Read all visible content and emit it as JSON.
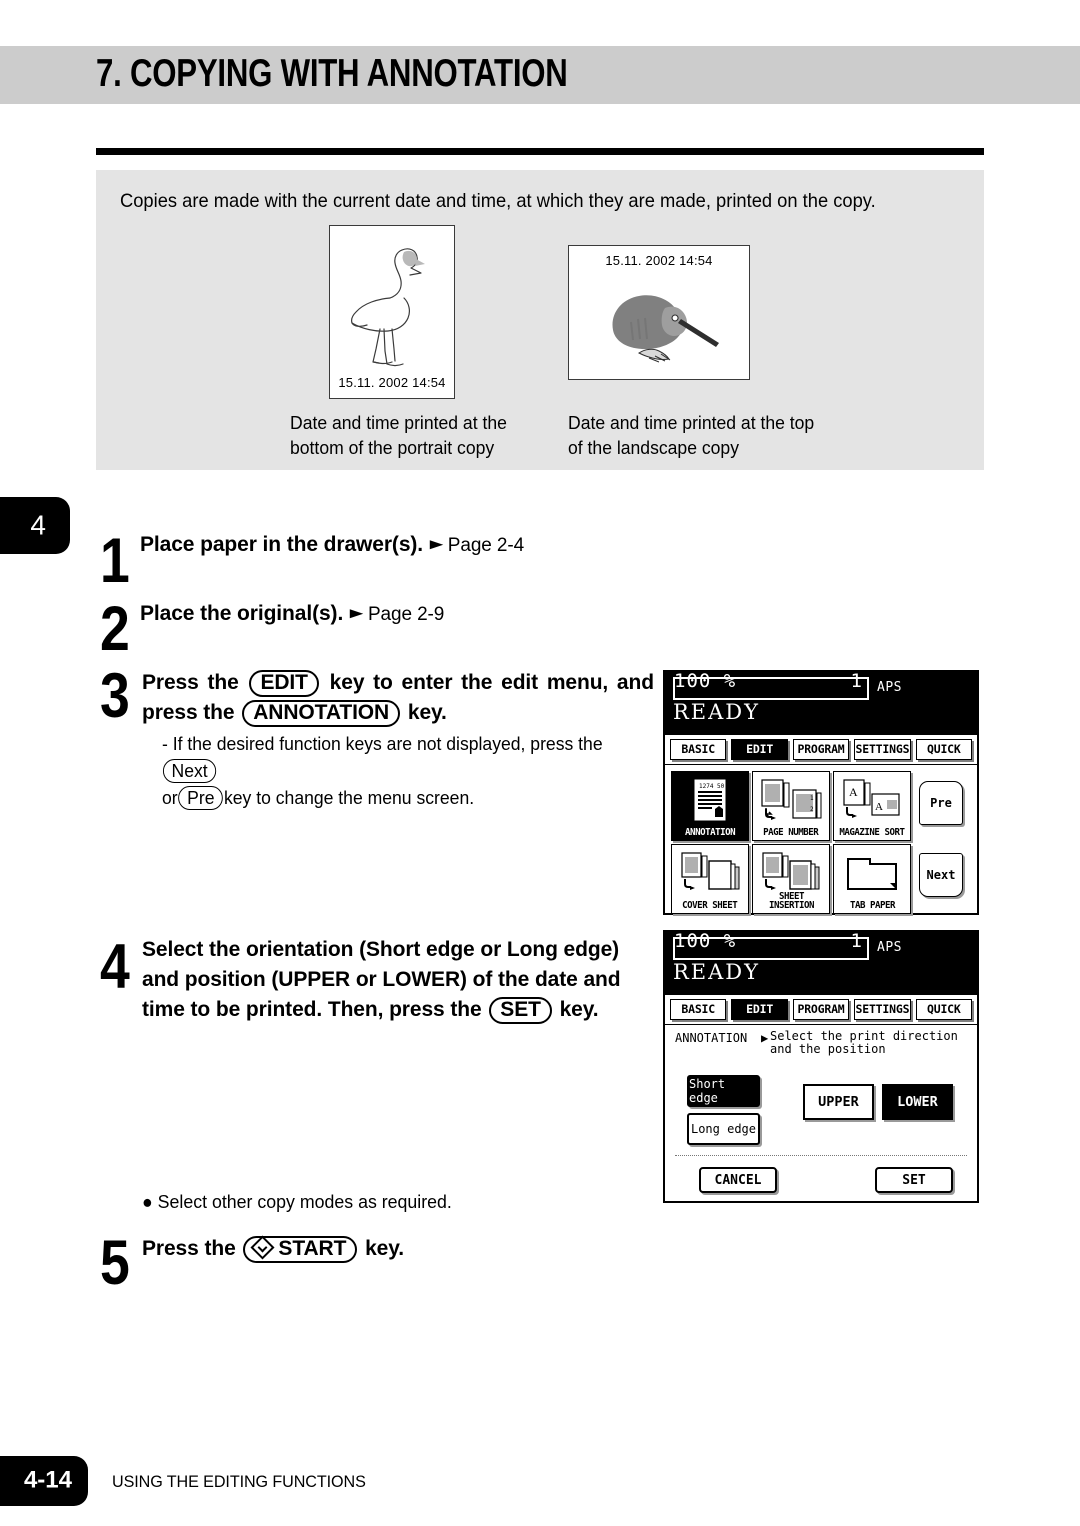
{
  "header": {
    "chapter_title": "7. COPYING WITH ANNOTATION",
    "chapter_tab_number": "4"
  },
  "intro": {
    "description": "Copies are made with the current date and time, at which they are made, printed on the copy.",
    "portrait_sample": {
      "icon": "flamingo-illustration",
      "stamp": "15.11. 2002  14:54",
      "caption": "Date and time printed at the\nbottom of the portrait copy"
    },
    "landscape_sample": {
      "icon": "kiwi-bird-illustration",
      "stamp": "15.11. 2002  14:54",
      "caption": "Date and time printed at the top\nof the landscape copy"
    }
  },
  "steps": [
    {
      "number": "1",
      "text": "Place paper in the drawer(s).",
      "page_ref": "Page 2-4"
    },
    {
      "number": "2",
      "text": "Place the original(s).",
      "page_ref": "Page 2-9"
    },
    {
      "number": "3",
      "text_part1": "Press the",
      "key1": "EDIT",
      "text_part2": "key to enter the edit menu, and",
      "text_part3": "press the",
      "key2": "ANNOTATION",
      "text_part4": "key.",
      "note_part1": "-  If the desired function keys are not displayed, press the",
      "note_key1": "Next",
      "note_part2": "or",
      "note_key2": "Pre",
      "note_part3": "key to change the menu screen."
    },
    {
      "number": "4",
      "line1": "Select the orientation (Short edge or Long edge)",
      "line2": "and position (UPPER or LOWER) of the date and",
      "line3_part1": "time to be printed. Then, press the",
      "key": "SET",
      "line3_part2": "key."
    },
    {
      "number": "5",
      "bullet": "Select other copy modes as required.",
      "text_part1": "Press the",
      "key": "START",
      "text_part2": "key."
    }
  ],
  "lcd_edit_menu": {
    "ratio": "100 %",
    "copies": "1",
    "paper_mode": "APS",
    "status": "READY",
    "tabs": [
      {
        "label": "BASIC",
        "active": false
      },
      {
        "label": "EDIT",
        "active": true
      },
      {
        "label": "PROGRAM",
        "active": false
      },
      {
        "label": "SETTINGS",
        "active": false
      },
      {
        "label": "QUICK",
        "active": false
      }
    ],
    "function_keys": [
      {
        "label": "ANNOTATION",
        "icon": "annotation-page-icon",
        "active": true
      },
      {
        "label": "PAGE NUMBER",
        "icon": "page-number-icon",
        "active": false
      },
      {
        "label": "MAGAZINE SORT",
        "icon": "magazine-sort-icon",
        "active": false
      },
      {
        "label": "COVER SHEET",
        "icon": "cover-sheet-icon",
        "active": false
      },
      {
        "label": "SHEET\nINSERTION",
        "icon": "sheet-insertion-icon",
        "active": false
      },
      {
        "label": "TAB PAPER",
        "icon": "tab-paper-icon",
        "active": false
      }
    ],
    "pager": {
      "previous_label": "Pre",
      "next_label": "Next"
    }
  },
  "lcd_annotation_setup": {
    "ratio": "100 %",
    "copies": "1",
    "paper_mode": "APS",
    "status": "READY",
    "tabs": [
      {
        "label": "BASIC",
        "active": false
      },
      {
        "label": "EDIT",
        "active": true
      },
      {
        "label": "PROGRAM",
        "active": false
      },
      {
        "label": "SETTINGS",
        "active": false
      },
      {
        "label": "QUICK",
        "active": false
      }
    ],
    "mode_label": "ANNOTATION",
    "caret": "▶",
    "prompt": "Select the print direction\nand the position",
    "orientation": [
      {
        "label": "Short edge",
        "active": true
      },
      {
        "label": "Long edge",
        "active": false
      }
    ],
    "position": [
      {
        "label": "UPPER",
        "active": false
      },
      {
        "label": "LOWER",
        "active": true
      }
    ],
    "cancel_label": "CANCEL",
    "set_label": "SET"
  },
  "footer": {
    "page_number": "4-14",
    "section_title": "USING THE EDITING FUNCTIONS"
  },
  "colors": {
    "header_gray": "#cccccc",
    "panel_gray": "#e4e4e4",
    "ink": "#000000"
  }
}
